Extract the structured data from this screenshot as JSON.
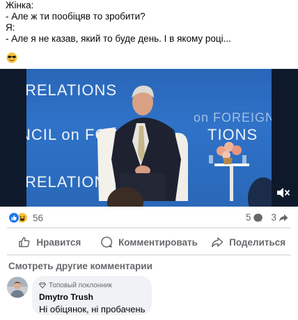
{
  "post": {
    "lines": [
      "Жінка:",
      "- Але ж ти пообіцяв то зробити?",
      "Я:",
      "- Але я не казав, який то буде день. І в якому році..."
    ],
    "emoji": "sunglasses-emoji"
  },
  "video": {
    "backdrop_text": [
      "RELATIONS",
      "on FOREIGN R",
      "NCIL on FORE",
      "TIONS",
      "RELATIONS"
    ],
    "muted": true
  },
  "reactions": {
    "count": "56",
    "icons": [
      "like-icon",
      "haha-icon"
    ]
  },
  "stats": {
    "comments": "5",
    "shares": "3"
  },
  "actions": {
    "like": "Нравится",
    "comment": "Комментировать",
    "share": "Поделиться"
  },
  "comments_link": "Смотреть другие комментарии",
  "comment": {
    "badge": "Топовый поклонник",
    "author": "Dmytro Trush",
    "text": "Ні обіцянок, ні пробачень"
  },
  "colors": {
    "facebook_blue": "#1877f2",
    "muted_text": "#65676b",
    "bubble": "#f0f2f5"
  }
}
